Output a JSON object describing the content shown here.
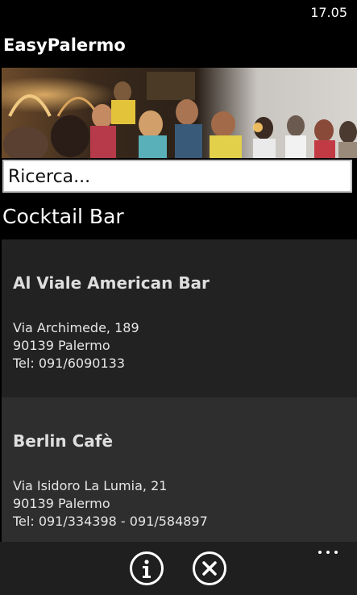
{
  "status_bar": {
    "time": "17.05"
  },
  "app": {
    "title": "EasyPalermo"
  },
  "banner": {
    "image": "nightlife crowd photo"
  },
  "search": {
    "placeholder": "Ricerca...",
    "value": ""
  },
  "section": {
    "title": "Cocktail Bar"
  },
  "listings": [
    {
      "name": "Al Viale American Bar",
      "address": "Via Archimede, 189",
      "city": "90139 Palermo",
      "phone": "Tel: 091/6090133"
    },
    {
      "name": "Berlin Cafè",
      "address": "Via Isidoro La Lumia, 21",
      "city": "90139 Palermo",
      "phone": "Tel: 091/334398 - 091/584897"
    }
  ],
  "app_bar": {
    "buttons": [
      {
        "icon": "info-icon"
      },
      {
        "icon": "close-icon"
      }
    ],
    "more_icon": "more-dots-icon"
  },
  "colors": {
    "background": "#000000",
    "item_bg_1": "#222222",
    "item_bg_2": "#2e2e2e",
    "app_bar": "#1f1f1f"
  }
}
